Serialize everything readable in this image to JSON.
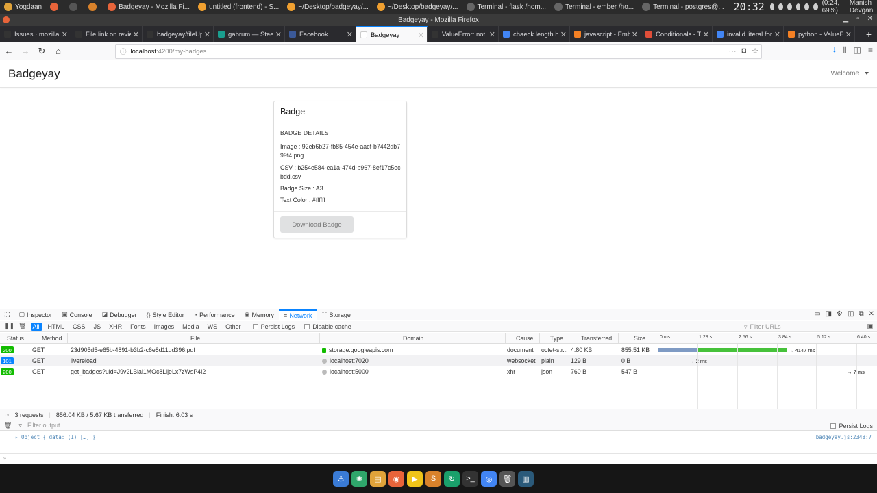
{
  "system_panel": {
    "tasks": [
      {
        "label": "Yogdaan",
        "color": "#e0a33a"
      },
      {
        "label": "",
        "color": "#e8643a"
      },
      {
        "label": "",
        "color": "#555555"
      },
      {
        "label": "",
        "color": "#d9822b"
      },
      {
        "label": "Badgeyay - Mozilla Fi...",
        "color": "#e8643a"
      },
      {
        "label": "untitled (frontend) - S...",
        "color": "#f0a030"
      },
      {
        "label": "~/Desktop/badgeyay/...",
        "color": "#f0a030"
      },
      {
        "label": "~/Desktop/badgeyay/...",
        "color": "#f0a030"
      },
      {
        "label": "Terminal - flask  /hom...",
        "color": "#666666"
      },
      {
        "label": "Terminal - ember  /ho...",
        "color": "#666666"
      },
      {
        "label": "Terminal - postgres@...",
        "color": "#666666"
      }
    ],
    "clock": "20:32",
    "battery": "(0:24, 69%)",
    "user": "Manish Devgan"
  },
  "window": {
    "title": "Badgeyay - Mozilla Firefox"
  },
  "browser": {
    "tabs": [
      {
        "label": "Issues · mozilla",
        "color": "#333333",
        "active": false
      },
      {
        "label": "File link on revie",
        "color": "#333333",
        "active": false
      },
      {
        "label": "badgeyay/fileUp",
        "color": "#333333",
        "active": false
      },
      {
        "label": "gabrum — Steem",
        "color": "#1a9e8f",
        "active": false
      },
      {
        "label": "Facebook",
        "color": "#3b5998",
        "active": false
      },
      {
        "label": "Badgeyay",
        "color": "#ffffff",
        "active": true
      },
      {
        "label": "ValueError: not e",
        "color": "#333333",
        "active": false
      },
      {
        "label": "chaeck length ha",
        "color": "#4285f4",
        "active": false
      },
      {
        "label": "javascript - Emb",
        "color": "#f48024",
        "active": false
      },
      {
        "label": "Conditionals - T",
        "color": "#e04e39",
        "active": false
      },
      {
        "label": "invalid literal for",
        "color": "#4285f4",
        "active": false
      },
      {
        "label": "python - ValueE",
        "color": "#f48024",
        "active": false
      }
    ],
    "url_host": "localhost",
    "url_path": ":4200/my-badges"
  },
  "app": {
    "brand": "Badgeyay",
    "welcome": "Welcome"
  },
  "badge_card": {
    "title": "Badge",
    "section": "BADGE DETAILS",
    "image_line": "Image : 92eb6b27-fb85-454e-aacf-b7442db799f4.png",
    "csv_line": "CSV : b254e584-ea1a-474d-b967-8ef17c5ecbdd.csv",
    "size_line": "Badge Size : A3",
    "color_line": "Text Color : #ffffff",
    "download_label": "Download Badge"
  },
  "devtools": {
    "tabs": [
      {
        "icon": "▢",
        "label": "Inspector"
      },
      {
        "icon": "▣",
        "label": "Console"
      },
      {
        "icon": "◪",
        "label": "Debugger"
      },
      {
        "icon": "{}",
        "label": "Style Editor"
      },
      {
        "icon": "◔",
        "label": "Performance"
      },
      {
        "icon": "◉",
        "label": "Memory"
      },
      {
        "icon": "≡",
        "label": "Network",
        "active": true
      },
      {
        "icon": "☷",
        "label": "Storage"
      }
    ],
    "filters": [
      "All",
      "HTML",
      "CSS",
      "JS",
      "XHR",
      "Fonts",
      "Images",
      "Media",
      "WS",
      "Other"
    ],
    "persist_logs": "Persist Logs",
    "disable_cache": "Disable cache",
    "filter_urls": "Filter URLs",
    "columns": {
      "status": "Status",
      "method": "Method",
      "file": "File",
      "domain": "Domain",
      "cause": "Cause",
      "type": "Type",
      "transferred": "Transferred",
      "size": "Size"
    },
    "timeline_ticks": [
      "0 ms",
      "1.28 s",
      "2.56 s",
      "3.84 s",
      "5.12 s",
      "6.40 s"
    ],
    "requests": [
      {
        "status": "200",
        "status_color": "#12bc00",
        "method": "GET",
        "file": "23d905d5-e65b-4891-b3b2-c6e8d11dd396.pdf",
        "domain": "storage.googleapis.com",
        "secure": true,
        "cause": "document",
        "type": "octet-str...",
        "transferred": "4.80 KB",
        "size": "855.51 KB",
        "timing": "→ 4147 ms"
      },
      {
        "status": "101",
        "status_color": "#0a84ff",
        "method": "GET",
        "file": "livereload",
        "domain": "localhost:7020",
        "secure": false,
        "cause": "websocket",
        "type": "plain",
        "transferred": "129 B",
        "size": "0 B",
        "timing": "→ 2 ms"
      },
      {
        "status": "200",
        "status_color": "#12bc00",
        "method": "GET",
        "file": "get_badges?uid=J9v2LBlai1MOc8LijeLx7zWsP4I2",
        "domain": "localhost:5000",
        "secure": false,
        "cause": "xhr",
        "type": "json",
        "transferred": "760 B",
        "size": "547 B",
        "timing": "→ 7 ms"
      }
    ],
    "summary": {
      "requests": "3 requests",
      "transferred": "856.04 KB / 5.67 KB transferred",
      "finish": "Finish: 6.03 s"
    },
    "console_filter": "Filter output",
    "console_persist": "Persist Logs",
    "console_message": "▸ Object { data: (1) […] }",
    "console_source": "badgeyay.js:2348:7",
    "console_prompt": "»"
  },
  "dock": {
    "icons": [
      {
        "name": "anchor-icon",
        "color": "#3a7bd5",
        "glyph": "⚓"
      },
      {
        "name": "settings-icon",
        "color": "#2fa66b",
        "glyph": "✺"
      },
      {
        "name": "files-icon",
        "color": "#e0a33a",
        "glyph": "▤"
      },
      {
        "name": "firefox-icon",
        "color": "#e8643a",
        "glyph": "◉"
      },
      {
        "name": "media-icon",
        "color": "#f0c419",
        "glyph": "▶"
      },
      {
        "name": "sublime-icon",
        "color": "#d9822b",
        "glyph": "S"
      },
      {
        "name": "refresh-icon",
        "color": "#1aa06b",
        "glyph": "↻"
      },
      {
        "name": "terminal-icon",
        "color": "#333333",
        "glyph": ">_"
      },
      {
        "name": "chrome-icon",
        "color": "#4285f4",
        "glyph": "◎"
      },
      {
        "name": "trash-icon",
        "color": "#555555",
        "glyph": "🗑"
      },
      {
        "name": "window-icon",
        "color": "#2b5a7a",
        "glyph": "▥"
      }
    ]
  }
}
